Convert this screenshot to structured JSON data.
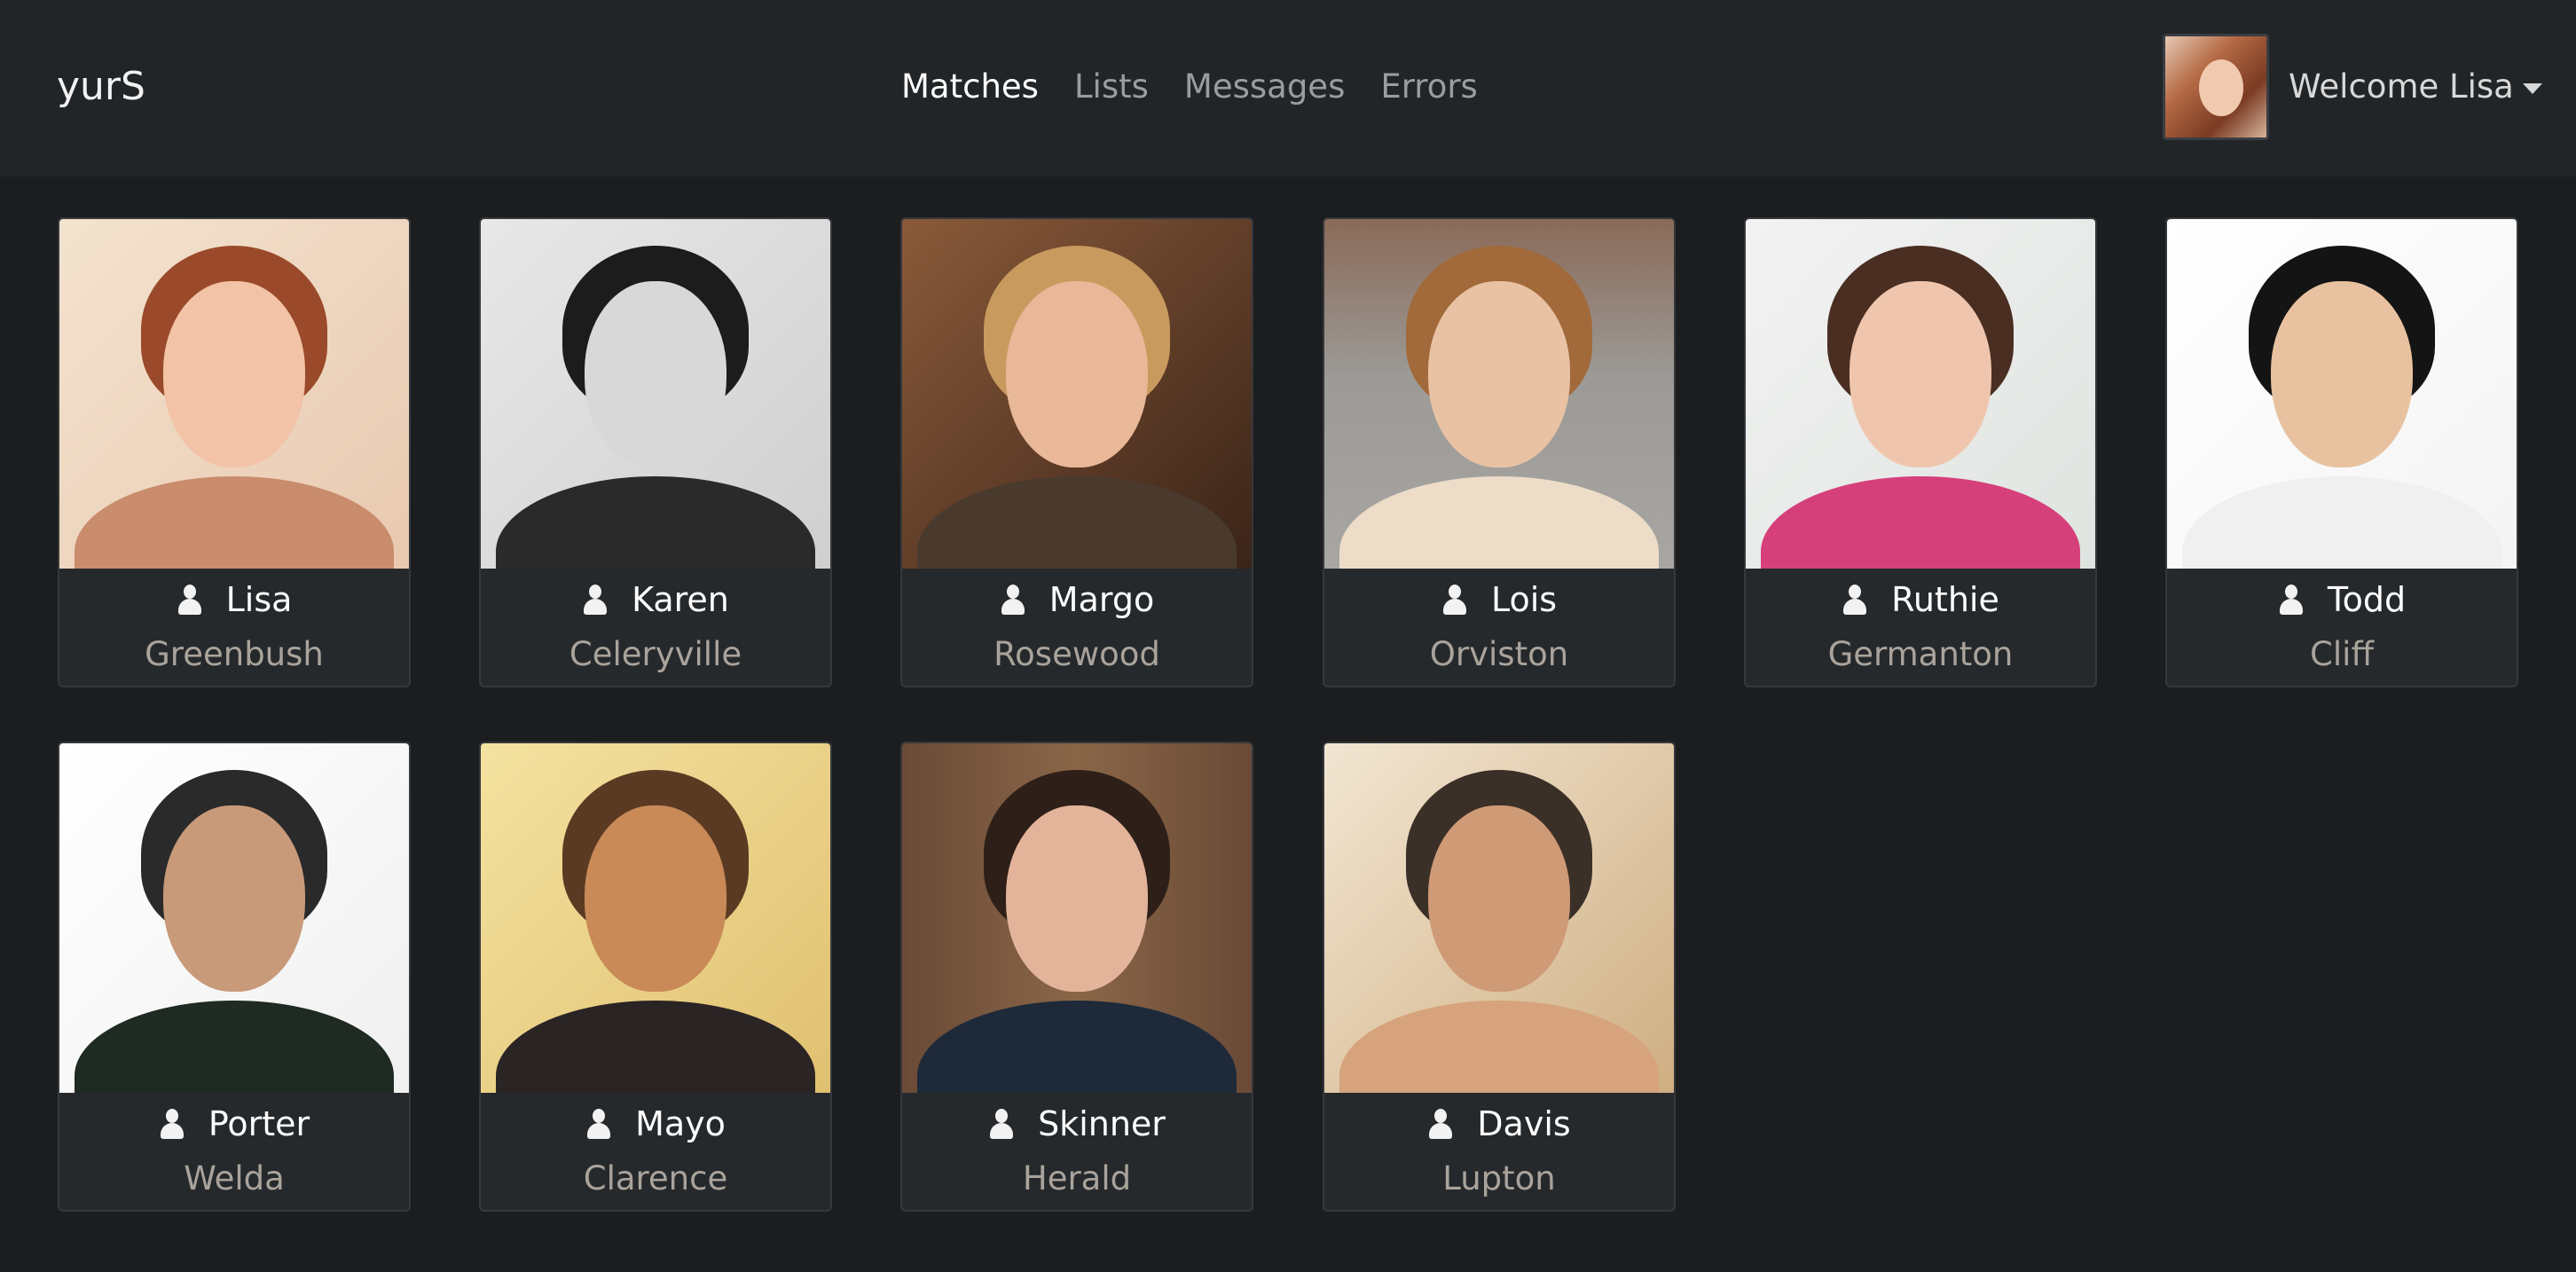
{
  "app": {
    "brand": "yurS"
  },
  "nav": {
    "links": [
      "Matches",
      "Lists",
      "Messages",
      "Errors"
    ],
    "active": "Matches"
  },
  "user_menu": {
    "welcome": "Welcome Lisa"
  },
  "matches": [
    {
      "name": "Lisa",
      "city": "Greenbush"
    },
    {
      "name": "Karen",
      "city": "Celeryville"
    },
    {
      "name": "Margo",
      "city": "Rosewood"
    },
    {
      "name": "Lois",
      "city": "Orviston"
    },
    {
      "name": "Ruthie",
      "city": "Germanton"
    },
    {
      "name": "Todd",
      "city": "Cliff"
    },
    {
      "name": "Porter",
      "city": "Welda"
    },
    {
      "name": "Mayo",
      "city": "Clarence"
    },
    {
      "name": "Skinner",
      "city": "Herald"
    },
    {
      "name": "Davis",
      "city": "Lupton"
    }
  ]
}
